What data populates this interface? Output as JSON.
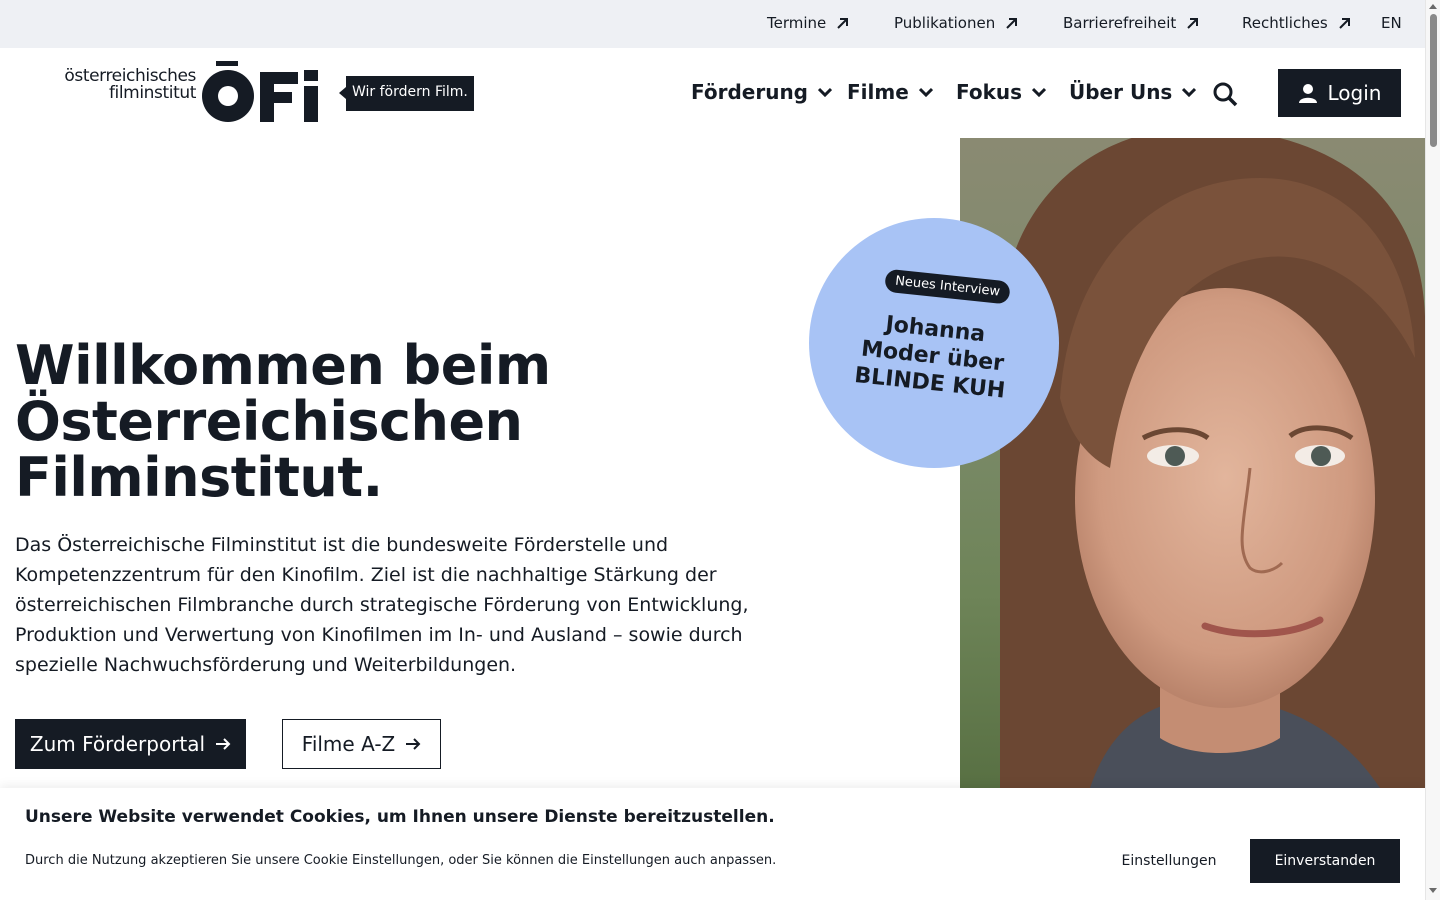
{
  "utility_nav": {
    "items": [
      {
        "label": "Termine"
      },
      {
        "label": "Publikationen"
      },
      {
        "label": "Barrierefreiheit"
      },
      {
        "label": "Rechtliches"
      }
    ],
    "language": "EN"
  },
  "logo": {
    "line1": "österreichisches",
    "line2": "filminstitut",
    "mark": "ÖFI",
    "tagline": "Wir fördern Film."
  },
  "main_nav": {
    "items": [
      {
        "label": "Förderung"
      },
      {
        "label": "Filme"
      },
      {
        "label": "Fokus"
      },
      {
        "label": "Über Uns"
      }
    ],
    "login_label": "Login"
  },
  "hero": {
    "title_line1": "Willkommen beim",
    "title_line2": "Österreichischen",
    "title_line3": "Filminstitut.",
    "text": "Das Österreichische Filminstitut ist die bundesweite Förderstelle und Kompetenzzentrum für den Kinofilm. Ziel ist die nachhaltige Stärkung der österreichischen Filmbranche durch strategische Förderung von Entwicklung, Produktion und Verwertung von Kinofilmen im In- und Ausland – sowie durch spezielle Nachwuchsförderung und Weiterbildungen.",
    "primary_button": "Zum Förderportal",
    "secondary_button": "Filme A-Z"
  },
  "interview_bubble": {
    "badge": "Neues Interview",
    "line1": "Johanna",
    "line2": "Moder über",
    "line3": "BLINDE KUH"
  },
  "cookie_banner": {
    "title": "Unsere Website verwendet Cookies, um Ihnen unsere Dienste bereitzustellen.",
    "text": "Durch die Nutzung akzeptieren Sie unsere Cookie Einstellungen, oder Sie können die Einstellungen auch anpassen.",
    "settings_label": "Einstellungen",
    "accept_label": "Einverstanden"
  },
  "colors": {
    "primary": "#151b24",
    "utility_bar": "#eef0f4",
    "bubble": "#a8c3f5"
  },
  "icons": [
    "arrow-up-right-icon",
    "chevron-down-icon",
    "search-icon",
    "user-icon",
    "arrow-right-icon"
  ]
}
